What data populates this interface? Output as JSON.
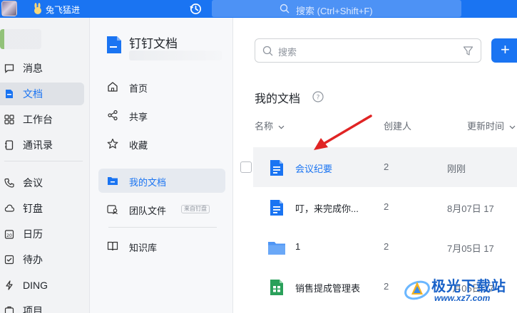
{
  "colors": {
    "accent": "#1a74f2",
    "arrow": "#e02424",
    "folder": "#4e95f5",
    "sheet": "#2aa05a"
  },
  "titlebar": {
    "username": "兔飞猛进",
    "search_placeholder": "搜索 (Ctrl+Shift+F)",
    "icons": [
      "history-icon",
      "search-icon"
    ]
  },
  "nav": {
    "items": [
      {
        "label": "消息",
        "icon": "message-icon"
      },
      {
        "label": "文档",
        "icon": "doc-icon",
        "active": true
      },
      {
        "label": "工作台",
        "icon": "grid-icon"
      },
      {
        "label": "通讯录",
        "icon": "contacts-icon"
      },
      {
        "label": "会议",
        "icon": "phone-icon"
      },
      {
        "label": "钉盘",
        "icon": "cloud-icon"
      },
      {
        "label": "日历",
        "icon": "calendar-icon"
      },
      {
        "label": "待办",
        "icon": "todo-icon"
      },
      {
        "label": "DING",
        "icon": "lightning-icon"
      },
      {
        "label": "项目",
        "icon": "project-icon"
      }
    ]
  },
  "docs_panel": {
    "title": "钉钉文档",
    "items": [
      {
        "label": "首页",
        "icon": "home-icon"
      },
      {
        "label": "共享",
        "icon": "share-icon"
      },
      {
        "label": "收藏",
        "icon": "star-icon"
      },
      {
        "label": "我的文档",
        "icon": "folder-icon",
        "active": true
      },
      {
        "label": "团队文件",
        "icon": "team-icon",
        "badge": "来自钉盘"
      },
      {
        "label": "知识库",
        "icon": "book-icon"
      }
    ]
  },
  "main": {
    "search_placeholder": "搜索",
    "new_button": "+",
    "section_title": "我的文档",
    "columns": {
      "name": "名称",
      "creator": "创建人",
      "updated": "更新时间"
    },
    "rows": [
      {
        "name": "会议纪要",
        "type": "doc",
        "creator": "2",
        "updated": "刚刚"
      },
      {
        "name": "叮，来完成你...",
        "type": "doc",
        "creator": "2",
        "updated": "8月07日 17"
      },
      {
        "name": "1",
        "type": "folder",
        "creator": "2",
        "updated": "7月05日 17"
      },
      {
        "name": "销售提成管理表",
        "type": "sheet",
        "creator": "2",
        "updated": "7月05日 17"
      }
    ]
  },
  "watermark": {
    "title": "极光下载站",
    "url": "www.xz7.com"
  }
}
